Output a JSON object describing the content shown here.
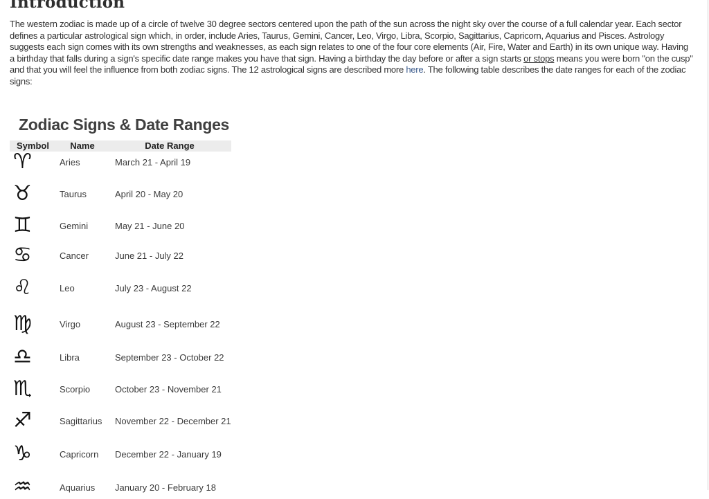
{
  "intro": {
    "heading": "Introduction",
    "p1": "The western zodiac is made up of a circle of twelve 30 degree sectors centered upon the path of the sun across the night sky over the course of a full calendar year.  Each sector defines a particular astrological sign which, in order, include Aries, Taurus, Gemini, Cancer, Leo, Virgo, Libra, Scorpio, Sagittarius, Capricorn, Aquarius and Pisces.  Astrology suggests each sign comes with its own strengths and weaknesses, as each sign relates to one of the four core elements (Air, Fire, Water and Earth) in its own unique way.  Having a birthday that falls during a sign's specific date range makes you have that sign.  Having a birthday the day before or after a sign starts ",
    "underlined": "or stops",
    "p2": " means you were born \"on the cusp\" and that you will feel the influence from both zodiac signs.  The 12 astrological signs are described more ",
    "link": "here",
    "p3": ".  The following table describes the date ranges for each of the zodiac signs:",
    "link_color": "#3b5b8c"
  },
  "table": {
    "title": "Zodiac Signs & Date Ranges",
    "headers": {
      "symbol": "Symbol",
      "name": "Name",
      "date": "Date Range"
    },
    "rows": [
      {
        "icon": "aries-icon",
        "symbol": "♈︎",
        "name": "Aries",
        "date": "March 21 - April 19"
      },
      {
        "icon": "taurus-icon",
        "symbol": "♉︎",
        "name": "Taurus",
        "date": "April 20 - May 20"
      },
      {
        "icon": "gemini-icon",
        "symbol": "♊︎",
        "name": "Gemini",
        "date": "May 21 - June 20"
      },
      {
        "icon": "cancer-icon",
        "symbol": "♋︎",
        "name": "Cancer",
        "date": "June 21 - July 22"
      },
      {
        "icon": "leo-icon",
        "symbol": "♌︎",
        "name": "Leo",
        "date": "July 23 - August 22"
      },
      {
        "icon": "virgo-icon",
        "symbol": "♍︎",
        "name": "Virgo",
        "date": "August 23 - September 22"
      },
      {
        "icon": "libra-icon",
        "symbol": "♎︎",
        "name": "Libra",
        "date": "September 23 - October 22"
      },
      {
        "icon": "scorpio-icon",
        "symbol": "♏︎",
        "name": "Scorpio",
        "date": "October 23 - November 21"
      },
      {
        "icon": "sagittarius-icon",
        "symbol": "♐︎",
        "name": "Sagittarius",
        "date": "November 22 - December 21"
      },
      {
        "icon": "capricorn-icon",
        "symbol": "♑︎",
        "name": "Capricorn",
        "date": "December 22 - January 19"
      },
      {
        "icon": "aquarius-icon",
        "symbol": "♒︎",
        "name": "Aquarius",
        "date": "January 20 - February 18"
      }
    ]
  }
}
